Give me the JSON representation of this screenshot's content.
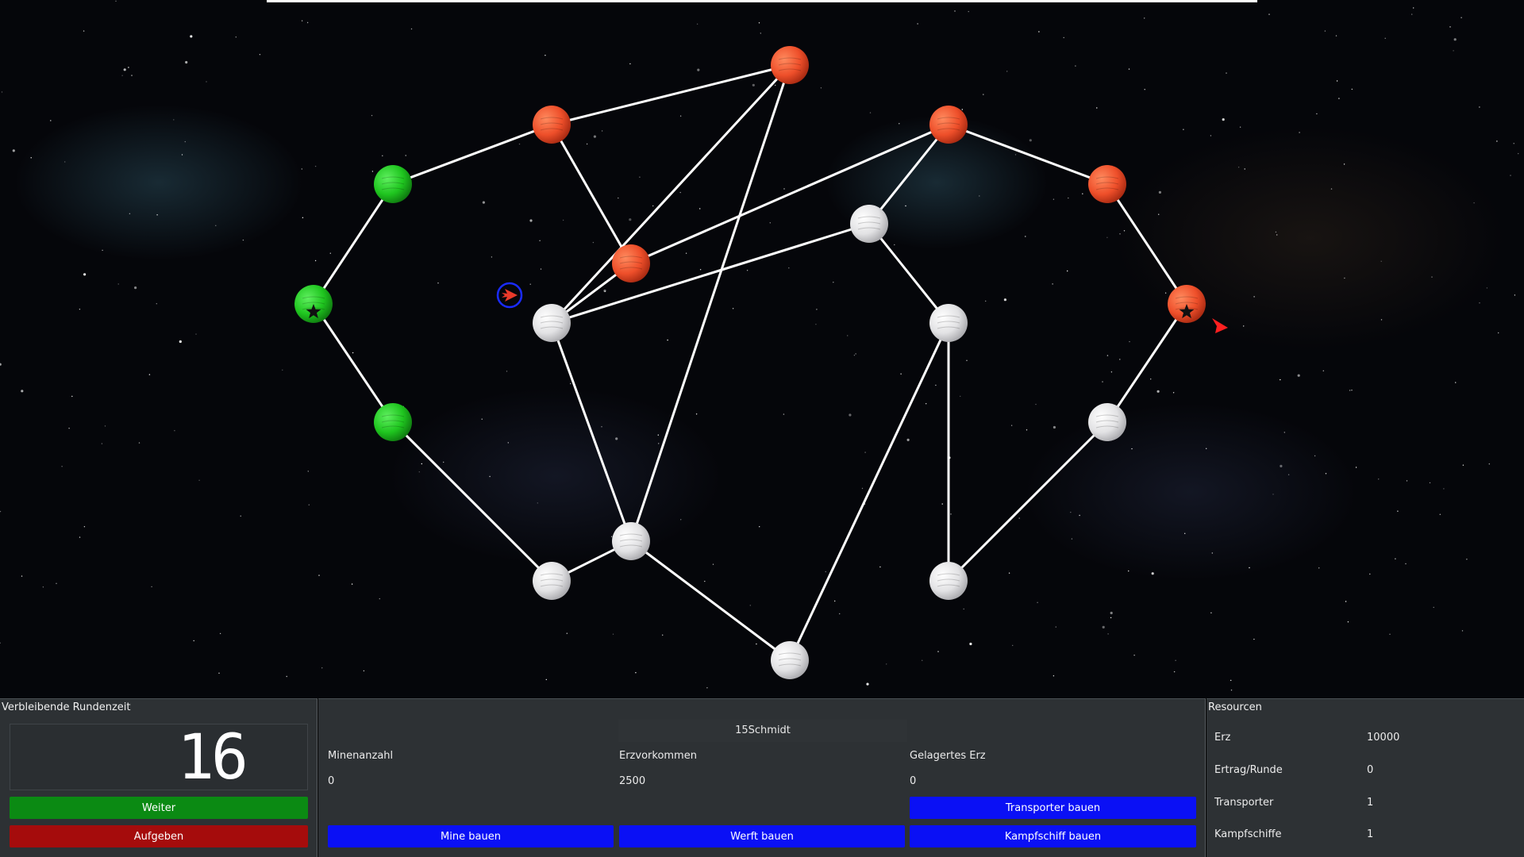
{
  "colors": {
    "player": "#1fc51f",
    "enemy": "#f0532c",
    "neutral": "#e4e4e6",
    "lane": "#ffffff",
    "weiter": "#0b8a13",
    "aufgeben": "#a50c0c",
    "action": "#0a10f5"
  },
  "map": {
    "planets": [
      {
        "id": "p1",
        "owner": "player",
        "home": false
      },
      {
        "id": "p2",
        "owner": "player",
        "home": true
      },
      {
        "id": "p3",
        "owner": "player",
        "home": false
      },
      {
        "id": "p4",
        "owner": "enemy",
        "home": false
      },
      {
        "id": "p5",
        "owner": "enemy",
        "home": false
      },
      {
        "id": "p6",
        "owner": "neutral",
        "home": false
      },
      {
        "id": "p7",
        "owner": "enemy",
        "home": false
      },
      {
        "id": "p8",
        "owner": "enemy",
        "home": false
      },
      {
        "id": "p9",
        "owner": "neutral",
        "home": false
      },
      {
        "id": "p10",
        "owner": "enemy",
        "home": false
      },
      {
        "id": "p11",
        "owner": "neutral",
        "home": false
      },
      {
        "id": "p12",
        "owner": "enemy",
        "home": true
      },
      {
        "id": "p13",
        "owner": "neutral",
        "home": false
      },
      {
        "id": "p14",
        "owner": "neutral",
        "home": false
      },
      {
        "id": "p15",
        "owner": "neutral",
        "home": false
      },
      {
        "id": "p16",
        "owner": "neutral",
        "home": false
      },
      {
        "id": "p17",
        "owner": "neutral",
        "home": false
      }
    ],
    "lanes": [
      [
        "p1",
        "p2"
      ],
      [
        "p2",
        "p3"
      ],
      [
        "p1",
        "p4"
      ],
      [
        "p4",
        "p5"
      ],
      [
        "p4",
        "p7"
      ],
      [
        "p5",
        "p6"
      ],
      [
        "p5",
        "p8"
      ],
      [
        "p6",
        "p7"
      ],
      [
        "p6",
        "p16"
      ],
      [
        "p6",
        "p9"
      ],
      [
        "p7",
        "p16"
      ],
      [
        "p8",
        "p10"
      ],
      [
        "p8",
        "p9"
      ],
      [
        "p9",
        "p11"
      ],
      [
        "p10",
        "p12"
      ],
      [
        "p11",
        "p14"
      ],
      [
        "p11",
        "p15"
      ],
      [
        "p12",
        "p13"
      ],
      [
        "p13",
        "p14"
      ],
      [
        "p3",
        "p17"
      ],
      [
        "p17",
        "p16"
      ],
      [
        "p16",
        "p15"
      ]
    ],
    "ships": [
      {
        "id": "player-ship",
        "owner": "player",
        "selected": true
      },
      {
        "id": "enemy-ship",
        "owner": "enemy",
        "selected": false
      }
    ]
  },
  "turn_panel": {
    "title": "Verbleibende Rundenzeit",
    "time_left": "16",
    "next_label": "Weiter",
    "surrender_label": "Aufgeben"
  },
  "planet_panel": {
    "name": "15Schmidt",
    "mine_count_label": "Minenanzahl",
    "mine_count": "0",
    "ore_deposit_label": "Erzvorkommen",
    "ore_deposit": "2500",
    "stored_ore_label": "Gelagertes Erz",
    "stored_ore": "0",
    "build_mine_label": "Mine bauen",
    "build_shipyard_label": "Werft bauen",
    "build_transporter_label": "Transporter bauen",
    "build_warship_label": "Kampfschiff bauen"
  },
  "resources_panel": {
    "title": "Resourcen",
    "rows": [
      {
        "label": "Erz",
        "value": "10000"
      },
      {
        "label": "Ertrag/Runde",
        "value": "0"
      },
      {
        "label": "Transporter",
        "value": "1"
      },
      {
        "label": "Kampfschiffe",
        "value": "1"
      }
    ]
  }
}
